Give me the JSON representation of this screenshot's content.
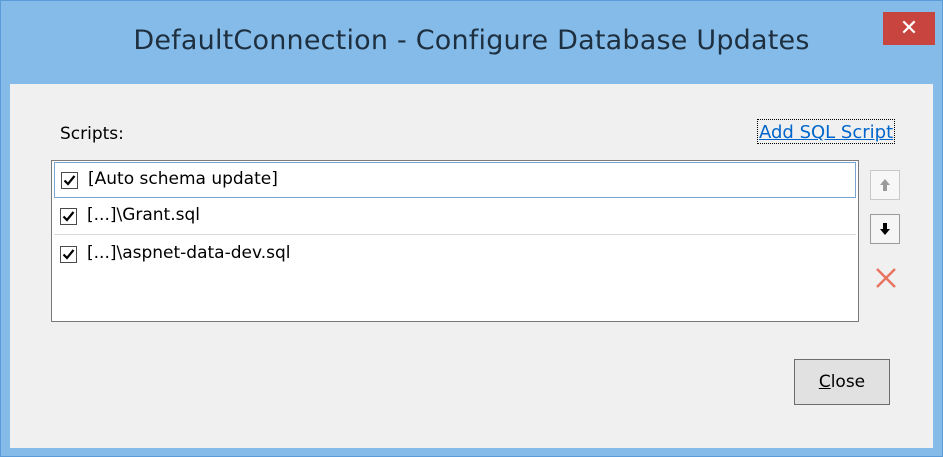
{
  "window": {
    "title": "DefaultConnection - Configure Database Updates",
    "close_glyph": "✕"
  },
  "dialog": {
    "scripts_label": "Scripts:",
    "add_sql_script_link": "Add SQL Script",
    "scripts": [
      {
        "label": "[Auto schema update]",
        "checked": true,
        "selected": true
      },
      {
        "label": "[...]\\Grant.sql",
        "checked": true,
        "selected": false
      },
      {
        "label": "[...]\\aspnet-data-dev.sql",
        "checked": true,
        "selected": false
      }
    ],
    "side_buttons": {
      "move_up_icon": "arrow-up-icon",
      "move_down_icon": "arrow-down-icon",
      "delete_icon": "delete-x-icon"
    },
    "close_button": {
      "accelerator": "C",
      "rest": "lose"
    }
  },
  "colors": {
    "titlebar": "#85bbe8",
    "close_red": "#c8443f",
    "link": "#0066cc",
    "selection_border": "#7aa5d3",
    "delete_icon": "#e8735f"
  }
}
